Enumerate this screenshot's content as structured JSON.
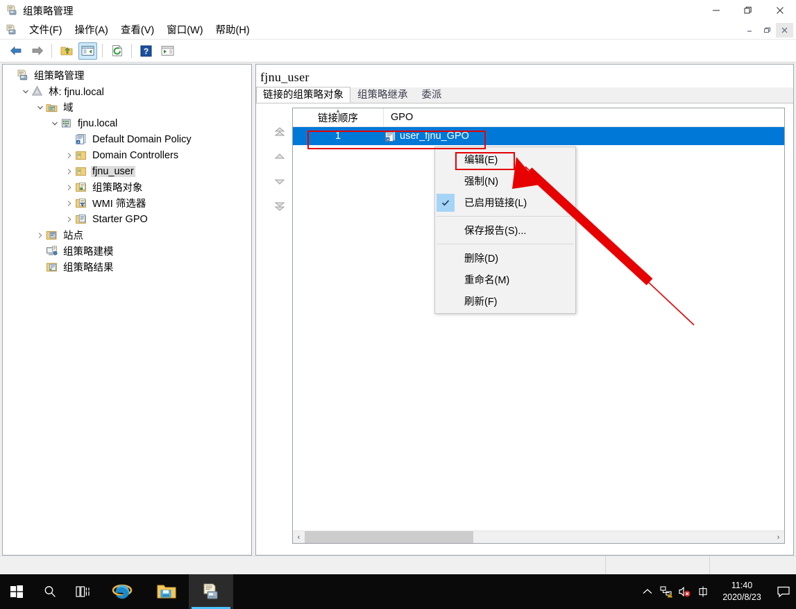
{
  "window": {
    "title": "组策略管理",
    "title_icon": "gpmc-icon",
    "controls": [
      {
        "name": "minimize-button",
        "glyph": "—"
      },
      {
        "name": "restore-button",
        "glyph": "❐"
      },
      {
        "name": "close-button",
        "glyph": "✕"
      }
    ]
  },
  "menubar": {
    "icon": "gpmc-icon",
    "items": [
      {
        "label": "文件(F)",
        "name": "menu-file"
      },
      {
        "label": "操作(A)",
        "name": "menu-action"
      },
      {
        "label": "查看(V)",
        "name": "menu-view"
      },
      {
        "label": "窗口(W)",
        "name": "menu-window"
      },
      {
        "label": "帮助(H)",
        "name": "menu-help"
      }
    ],
    "mdi_controls": [
      {
        "name": "mdi-minimize-button",
        "glyph": "—"
      },
      {
        "name": "mdi-restore-button",
        "glyph": "❐"
      },
      {
        "name": "mdi-close-button",
        "glyph": "✕"
      }
    ]
  },
  "toolbar": {
    "buttons": [
      {
        "name": "back-button",
        "icon": "back-arrow-icon",
        "enabled": true
      },
      {
        "name": "forward-button",
        "icon": "forward-arrow-icon",
        "enabled": true
      },
      {
        "name": "up-one-level-button",
        "icon": "folder-up-icon",
        "enabled": true
      },
      {
        "name": "show-hide-tree-button",
        "icon": "show-tree-icon",
        "active": true
      },
      {
        "name": "refresh-button",
        "icon": "refresh-icon",
        "enabled": true
      },
      {
        "name": "help-button",
        "icon": "help-question-icon",
        "enabled": true
      },
      {
        "name": "properties-button",
        "icon": "window-properties-icon",
        "enabled": true
      }
    ]
  },
  "tree": {
    "root_label": "组策略管理",
    "items": [
      {
        "label": "组策略管理",
        "indent": 0,
        "icon": "gpmc-icon",
        "twisty": "",
        "selected": false,
        "name": "tree-item-gpmc-root"
      },
      {
        "label": "林: fjnu.local",
        "indent": 1,
        "icon": "forest-icon",
        "twisty": "expanded",
        "selected": false,
        "name": "tree-item-forest"
      },
      {
        "label": "域",
        "indent": 2,
        "icon": "domains-icon",
        "twisty": "expanded",
        "selected": false,
        "name": "tree-item-domains"
      },
      {
        "label": "fjnu.local",
        "indent": 3,
        "icon": "domain-icon",
        "twisty": "expanded",
        "selected": false,
        "name": "tree-item-domain-fjnu-local"
      },
      {
        "label": "Default Domain Policy",
        "indent": 4,
        "icon": "gpo-link-icon",
        "twisty": "",
        "selected": false,
        "name": "tree-item-default-domain-policy"
      },
      {
        "label": "Domain Controllers",
        "indent": 4,
        "icon": "ou-icon",
        "twisty": "collapsed",
        "selected": false,
        "name": "tree-item-domain-controllers"
      },
      {
        "label": "fjnu_user",
        "indent": 4,
        "icon": "ou-icon",
        "twisty": "collapsed",
        "selected": true,
        "name": "tree-item-fjnu-user"
      },
      {
        "label": "组策略对象",
        "indent": 4,
        "icon": "gpo-container-icon",
        "twisty": "collapsed",
        "selected": false,
        "name": "tree-item-group-policy-objects"
      },
      {
        "label": "WMI 筛选器",
        "indent": 4,
        "icon": "wmi-filter-icon",
        "twisty": "collapsed",
        "selected": false,
        "name": "tree-item-wmi-filters"
      },
      {
        "label": "Starter GPO",
        "indent": 4,
        "icon": "starter-gpo-icon",
        "twisty": "collapsed",
        "selected": false,
        "name": "tree-item-starter-gpo"
      },
      {
        "label": "站点",
        "indent": 2,
        "icon": "sites-icon",
        "twisty": "collapsed",
        "selected": false,
        "name": "tree-item-sites"
      },
      {
        "label": "组策略建模",
        "indent": 2,
        "icon": "gp-modeling-icon",
        "twisty": "",
        "selected": false,
        "name": "tree-item-group-policy-modeling"
      },
      {
        "label": "组策略结果",
        "indent": 2,
        "icon": "gp-results-icon",
        "twisty": "",
        "selected": false,
        "name": "tree-item-group-policy-results"
      }
    ]
  },
  "right_pane": {
    "title": "fjnu_user",
    "tabs": [
      {
        "label": "链接的组策略对象",
        "active": true,
        "name": "tab-linked-gpos"
      },
      {
        "label": "组策略继承",
        "active": false,
        "name": "tab-gp-inheritance"
      },
      {
        "label": "委派",
        "active": false,
        "name": "tab-delegation"
      }
    ],
    "order_buttons": [
      {
        "name": "move-link-to-top-button",
        "icon": "double-up-arrow-icon"
      },
      {
        "name": "move-link-up-button",
        "icon": "up-arrow-icon"
      },
      {
        "name": "move-link-down-button",
        "icon": "down-arrow-icon"
      },
      {
        "name": "move-link-to-bottom-button",
        "icon": "double-down-arrow-icon"
      }
    ],
    "list": {
      "columns": [
        "链接顺序",
        "GPO"
      ],
      "sort_column": "链接顺序",
      "sort_direction": "asc",
      "rows": [
        {
          "order": "1",
          "gpo": "user_fjnu_GPO",
          "icon": "gpo-link-icon",
          "selected": true
        }
      ]
    },
    "scrollbar": {
      "left_arrow": "‹",
      "right_arrow": "›"
    }
  },
  "context_menu": {
    "items": [
      {
        "label": "编辑(E)",
        "name": "context-menu-edit",
        "checked": false,
        "highlighted": true
      },
      {
        "label": "强制(N)",
        "name": "context-menu-enforced",
        "checked": false
      },
      {
        "label": "已启用链接(L)",
        "name": "context-menu-link-enabled",
        "checked": true
      },
      {
        "separator": true
      },
      {
        "label": "保存报告(S)...",
        "name": "context-menu-save-report",
        "checked": false
      },
      {
        "separator": true
      },
      {
        "label": "删除(D)",
        "name": "context-menu-delete",
        "checked": false
      },
      {
        "label": "重命名(M)",
        "name": "context-menu-rename",
        "checked": false
      },
      {
        "label": "刷新(F)",
        "name": "context-menu-refresh",
        "checked": false
      }
    ]
  },
  "taskbar": {
    "buttons": [
      {
        "name": "start-button",
        "icon": "windows-logo-icon"
      },
      {
        "name": "search-button",
        "icon": "search-icon"
      },
      {
        "name": "task-view-button",
        "icon": "task-view-icon"
      },
      {
        "name": "internet-explorer-button",
        "icon": "internet-explorer-icon"
      },
      {
        "name": "file-explorer-button",
        "icon": "file-explorer-icon"
      },
      {
        "name": "gpmc-taskbar-button",
        "icon": "gpmc-icon",
        "running": true
      }
    ],
    "tray": {
      "chevron": "⌃",
      "icons": [
        {
          "name": "network-warning-icon"
        },
        {
          "name": "volume-muted-icon"
        },
        {
          "name": "ime-icon",
          "glyph": "中"
        }
      ],
      "time": "11:40",
      "date": "2020/8/23",
      "action_center": "notification-icon"
    }
  },
  "annotations": {
    "color": "#e60000",
    "boxes": [
      "selected-gpo-row",
      "context-menu-edit"
    ],
    "arrow": "points-to-edit-menu-item"
  },
  "colors": {
    "selection_blue": "#0078d7",
    "annotation_red": "#e60000",
    "menu_check_highlight": "#a6d4f7",
    "taskbar_bg": "#0a0a0a",
    "accent_underline": "#4cc2ff"
  }
}
